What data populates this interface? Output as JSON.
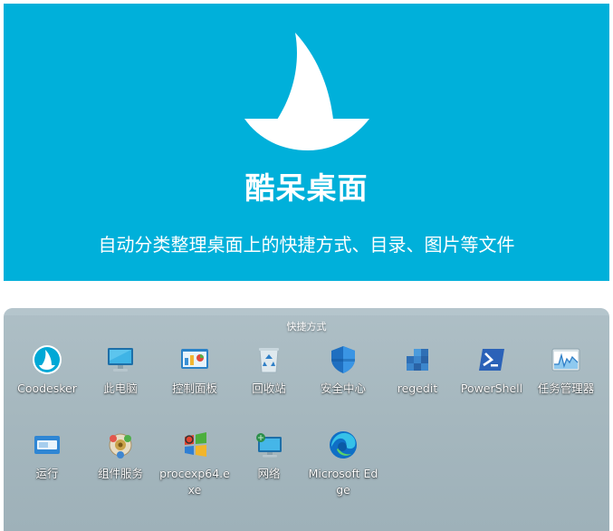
{
  "banner": {
    "title": "酷呆桌面",
    "subtitle": "自动分类整理桌面上的快捷方式、目录、图片等文件",
    "background_color": "#00b0da"
  },
  "desktop": {
    "group_title": "快捷方式",
    "icons": [
      {
        "label": "Coodesker",
        "icon": "coodesker-sail-icon"
      },
      {
        "label": "此电脑",
        "icon": "this-pc-icon"
      },
      {
        "label": "控制面板",
        "icon": "control-panel-icon"
      },
      {
        "label": "回收站",
        "icon": "recycle-bin-icon"
      },
      {
        "label": "安全中心",
        "icon": "security-shield-icon"
      },
      {
        "label": "regedit",
        "icon": "regedit-icon"
      },
      {
        "label": "PowerShell",
        "icon": "powershell-icon"
      },
      {
        "label": "任务管理器",
        "icon": "task-manager-icon"
      },
      {
        "label": "运行",
        "icon": "run-icon"
      },
      {
        "label": "组件服务",
        "icon": "component-services-icon"
      },
      {
        "label": "procexp64.exe",
        "icon": "procexp-icon"
      },
      {
        "label": "网络",
        "icon": "network-icon"
      },
      {
        "label": "Microsoft Edge",
        "icon": "edge-icon"
      }
    ]
  }
}
